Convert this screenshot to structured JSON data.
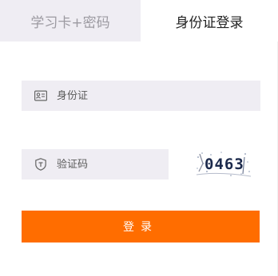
{
  "tabs": [
    {
      "label": "学习卡+密码",
      "active": false
    },
    {
      "label": "身份证登录",
      "active": true
    }
  ],
  "form": {
    "id_field": {
      "placeholder": "身份证",
      "value": "",
      "icon": "id-card-icon"
    },
    "captcha_field": {
      "placeholder": "验证码",
      "value": "",
      "icon": "shield-icon"
    },
    "captcha_image_text": "0463",
    "login_label": "登录"
  },
  "colors": {
    "accent": "#ff6d00",
    "input_bg": "#efedf3",
    "inactive_tab_bg": "#efedf3",
    "inactive_tab_text": "#9c9aa1"
  }
}
